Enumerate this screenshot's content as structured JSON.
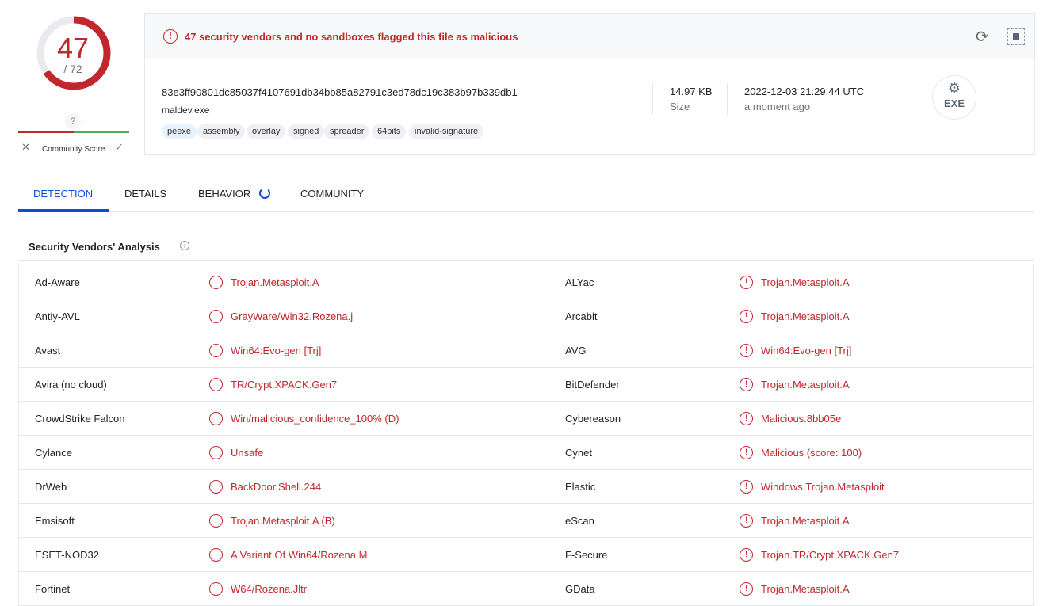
{
  "score": {
    "detections": "47",
    "total": "/ 72",
    "fraction": 0.653,
    "community_unknown": "?",
    "community_label": "Community Score"
  },
  "banner": {
    "text": "47 security vendors and no sandboxes flagged this file as malicious"
  },
  "file": {
    "hash": "83e3ff90801dc85037f4107691db34bb85a82791c3ed78dc19c383b97b339db1",
    "name": "maldev.exe",
    "tags": [
      "peexe",
      "assembly",
      "overlay",
      "signed",
      "spreader",
      "64bits",
      "invalid-signature"
    ],
    "size": "14.97 KB",
    "size_label": "Size",
    "date": "2022-12-03 21:29:44 UTC",
    "date_label": "a moment ago",
    "type": "EXE"
  },
  "tabs": [
    "DETECTION",
    "DETAILS",
    "BEHAVIOR",
    "COMMUNITY"
  ],
  "section": {
    "title": "Security Vendors' Analysis"
  },
  "colors": {
    "malicious": "#c1272d",
    "accent": "#0b4dda"
  },
  "vendors": [
    [
      "Ad-Aware",
      "Trojan.Metasploit.A",
      "ALYac",
      "Trojan.Metasploit.A"
    ],
    [
      "Antiy-AVL",
      "GrayWare/Win32.Rozena.j",
      "Arcabit",
      "Trojan.Metasploit.A"
    ],
    [
      "Avast",
      "Win64:Evo-gen [Trj]",
      "AVG",
      "Win64:Evo-gen [Trj]"
    ],
    [
      "Avira (no cloud)",
      "TR/Crypt.XPACK.Gen7",
      "BitDefender",
      "Trojan.Metasploit.A"
    ],
    [
      "CrowdStrike Falcon",
      "Win/malicious_confidence_100% (D)",
      "Cybereason",
      "Malicious.8bb05e"
    ],
    [
      "Cylance",
      "Unsafe",
      "Cynet",
      "Malicious (score: 100)"
    ],
    [
      "DrWeb",
      "BackDoor.Shell.244",
      "Elastic",
      "Windows.Trojan.Metasploit"
    ],
    [
      "Emsisoft",
      "Trojan.Metasploit.A (B)",
      "eScan",
      "Trojan.Metasploit.A"
    ],
    [
      "ESET-NOD32",
      "A Variant Of Win64/Rozena.M",
      "F-Secure",
      "Trojan.TR/Crypt.XPACK.Gen7"
    ],
    [
      "Fortinet",
      "W64/Rozena.Jltr",
      "GData",
      "Trojan.Metasploit.A"
    ]
  ]
}
